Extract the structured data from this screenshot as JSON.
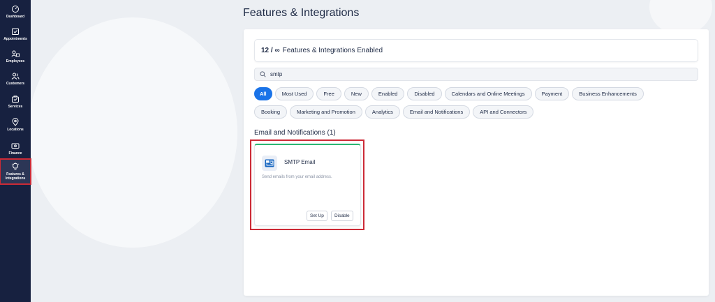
{
  "sidebar": {
    "items": [
      {
        "label": "Dashboard",
        "icon": "dashboard-icon"
      },
      {
        "label": "Appointments",
        "icon": "calendar-check-icon"
      },
      {
        "label": "Employees",
        "icon": "employees-icon"
      },
      {
        "label": "Customers",
        "icon": "customers-icon"
      },
      {
        "label": "Services",
        "icon": "services-icon"
      },
      {
        "label": "Locations",
        "icon": "location-pin-icon"
      },
      {
        "label": "Finance",
        "icon": "finance-icon"
      },
      {
        "label_line1": "Features &",
        "label_line2": "Integrations",
        "icon": "lightbulb-icon",
        "active": true
      }
    ]
  },
  "header": {
    "title": "Features & Integrations"
  },
  "summary": {
    "count": "12 / ∞",
    "text": "Features & Integrations Enabled"
  },
  "search": {
    "value": "smtp"
  },
  "filters": {
    "row1": [
      "All",
      "Most Used",
      "Free",
      "New",
      "Enabled",
      "Disabled",
      "Calendars and Online Meetings",
      "Payment",
      "Business Enhancements"
    ],
    "row2": [
      "Booking",
      "Marketing and Promotion",
      "Analytics",
      "Email and Notifications",
      "API and Connectors"
    ],
    "active": "All"
  },
  "section": {
    "title": "Email and Notifications (1)"
  },
  "feature": {
    "name": "SMTP Email",
    "description": "Send emails from your email address.",
    "setup_label": "Set Up",
    "disable_label": "Disable",
    "icon": "smtp-email-icon"
  },
  "colors": {
    "sidebar_bg": "#172140",
    "accent": "#1a73e8",
    "highlight": "#cc2a36",
    "enabled_bar": "#2bb673"
  }
}
